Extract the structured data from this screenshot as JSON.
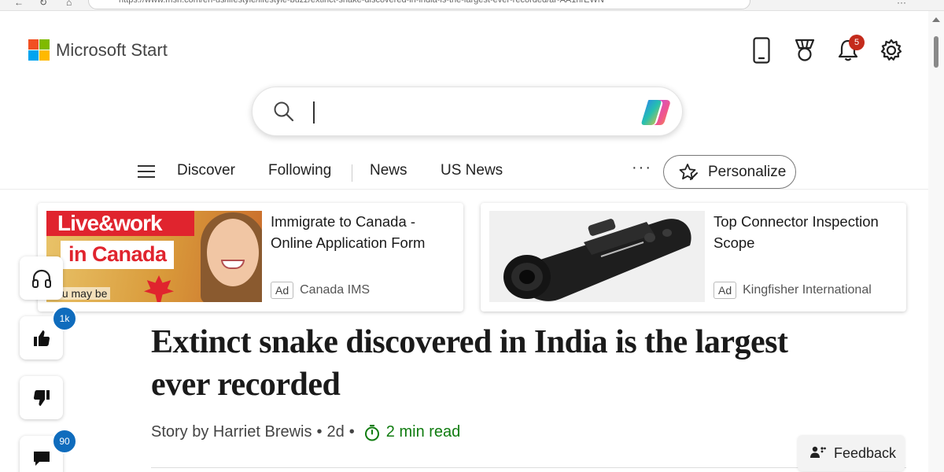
{
  "browser": {
    "url": "https://www.msn.com/en-us/lifestyle/lifestyle-buzz/extinct-snake-discovered-in-india-is-the-largest-ever-recorded/ar-AA1hrEWN"
  },
  "header": {
    "brand": "Microsoft Start",
    "notification_count": "5",
    "icons": [
      "phone-icon",
      "trophy-icon",
      "bell-icon",
      "gear-icon"
    ]
  },
  "search": {
    "value": "",
    "placeholder": ""
  },
  "nav": {
    "items": [
      "Discover",
      "Following",
      "News",
      "US News"
    ],
    "more": "···",
    "personalize_label": "Personalize"
  },
  "ads": [
    {
      "title": "Immigrate to Canada - Online Application Form",
      "badge": "Ad",
      "source": "Canada IMS",
      "image_text": [
        "Live&work",
        "in Canada",
        "You may be"
      ]
    },
    {
      "title": "Top Connector Inspection Scope",
      "badge": "Ad",
      "source": "Kingfisher International"
    }
  ],
  "rail": {
    "like_count": "1k",
    "comment_count": "90"
  },
  "article": {
    "headline": "Extinct snake discovered in India is the largest ever recorded",
    "byline": "Story by Harriet Brewis",
    "age": "2d",
    "separator": "•",
    "read_time": "2 min read"
  },
  "feedback": {
    "label": "Feedback"
  },
  "colors": {
    "notification_badge": "#c42b1c",
    "count_badge": "#0f6cbd",
    "read_time": "#107c10"
  }
}
